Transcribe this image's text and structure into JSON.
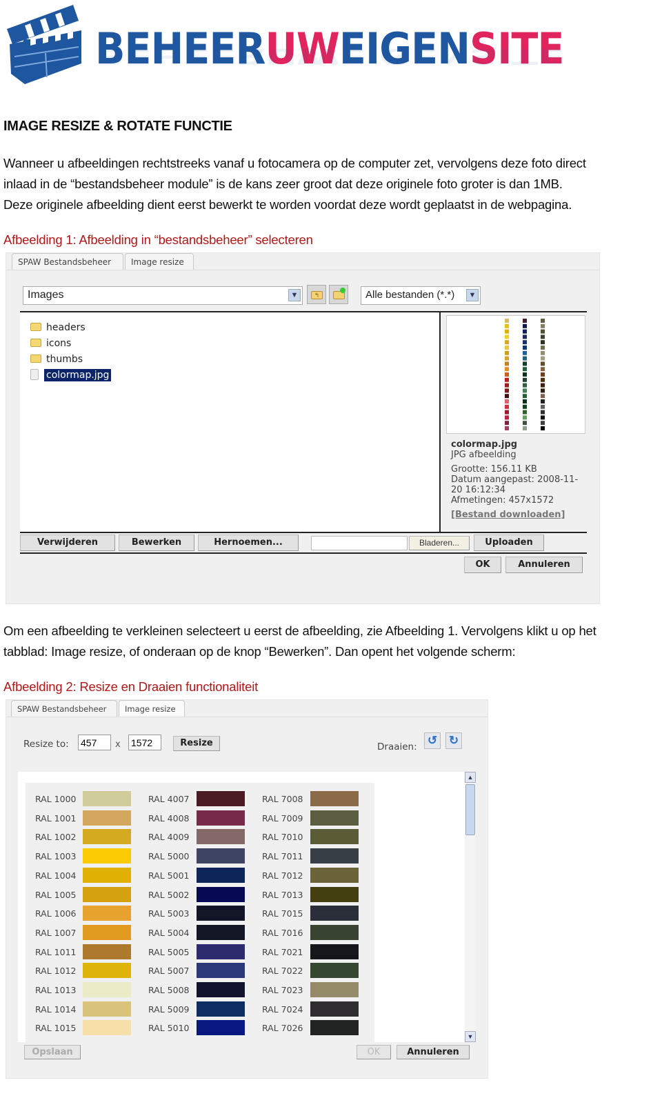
{
  "logo": {
    "part1": "BEHEER",
    "part2": "UW",
    "part3": "EIGEN",
    "part4": "SITE",
    "blue": "#1f56a0",
    "pink": "#e0245e"
  },
  "heading": "IMAGE RESIZE & ROTATE FUNCTIE",
  "intro": [
    "Wanneer u afbeeldingen rechtstreeks vanaf u fotocamera op de computer zet, vervolgens deze foto direct",
    "inlaad in de “bestandsbeheer module” is de kans zeer groot dat deze originele foto groter is dan 1MB.",
    "Deze originele afbeelding dient eerst bewerkt te worden voordat deze wordt geplaatst in de webpagina."
  ],
  "caption1": "Afbeelding 1: Afbeelding in “bestandsbeheer” selecteren",
  "dialog1": {
    "tabs": [
      "SPAW Bestandsbeheer",
      "Image resize"
    ],
    "folder_select": "Images",
    "filter_select": "Alle bestanden (*.*)",
    "files": [
      {
        "name": "headers",
        "type": "folder"
      },
      {
        "name": "icons",
        "type": "folder"
      },
      {
        "name": "thumbs",
        "type": "folder"
      },
      {
        "name": "colormap.jpg",
        "type": "file",
        "selected": true
      }
    ],
    "info": {
      "filename": "colormap.jpg",
      "filetype": "JPG afbeelding",
      "size": "Grootte: 156.11 KB",
      "date1": "Datum aangepast: 2008-11-",
      "date2": "20 16:12:34",
      "dims": "Afmetingen: 457x1572",
      "download": "[Bestand downloaden]"
    },
    "buttons": {
      "delete": "Verwijderen",
      "edit": "Bewerken",
      "rename": "Hernoemen...",
      "browse": "Bladeren...",
      "upload": "Uploaden",
      "ok": "OK",
      "cancel": "Annuleren"
    },
    "upload_value": ""
  },
  "para2": [
    "Om een afbeelding te verkleinen selecteert u eerst de afbeelding, zie Afbeelding 1. Vervolgens klikt u op het",
    "tabblad: Image resize, of onderaan op de knop “Bewerken”. Dan opent het volgende scherm:"
  ],
  "caption2": "Afbeelding 2: Resize en Draaien functionaliteit",
  "dialog2": {
    "tabs": [
      "SPAW Bestandsbeheer",
      "Image resize"
    ],
    "resize_label": "Resize to:",
    "width": "457",
    "x": "x",
    "height": "1572",
    "resize_button": "Resize",
    "rotate_label": "Draaien:",
    "save": "Opslaan",
    "ok": "OK",
    "cancel": "Annuleren",
    "colors": [
      [
        [
          "RAL 1000",
          "#cfcc9a"
        ],
        [
          "RAL 1001",
          "#d3a75e"
        ],
        [
          "RAL 1002",
          "#d2a91f"
        ],
        [
          "RAL 1003",
          "#fccb03"
        ],
        [
          "RAL 1004",
          "#e0b004"
        ],
        [
          "RAL 1005",
          "#d4a210"
        ],
        [
          "RAL 1006",
          "#e5a22c"
        ],
        [
          "RAL 1007",
          "#e09b20"
        ],
        [
          "RAL 1011",
          "#ad7a2d"
        ],
        [
          "RAL 1012",
          "#ddb50a"
        ],
        [
          "RAL 1013",
          "#ecebc8"
        ],
        [
          "RAL 1014",
          "#d8c27c"
        ],
        [
          "RAL 1015",
          "#f6dfa8"
        ]
      ],
      [
        [
          "RAL 4007",
          "#4b1c23"
        ],
        [
          "RAL 4008",
          "#772a4a"
        ],
        [
          "RAL 4009",
          "#836a68"
        ],
        [
          "RAL 5000",
          "#3d4563"
        ],
        [
          "RAL 5001",
          "#0e2559"
        ],
        [
          "RAL 5002",
          "#050a52"
        ],
        [
          "RAL 5003",
          "#121626"
        ],
        [
          "RAL 5004",
          "#131625"
        ],
        [
          "RAL 5005",
          "#2d2a6e"
        ],
        [
          "RAL 5007",
          "#2c3978"
        ],
        [
          "RAL 5008",
          "#12142e"
        ],
        [
          "RAL 5009",
          "#0e2e62"
        ],
        [
          "RAL 5010",
          "#081881"
        ]
      ],
      [
        [
          "RAL 7008",
          "#8b6a47"
        ],
        [
          "RAL 7009",
          "#5b5d40"
        ],
        [
          "RAL 7010",
          "#5b5b35"
        ],
        [
          "RAL 7011",
          "#383e45"
        ],
        [
          "RAL 7012",
          "#6a6438"
        ],
        [
          "RAL 7013",
          "#443f11"
        ],
        [
          "RAL 7015",
          "#2b2f39"
        ],
        [
          "RAL 7016",
          "#384431"
        ],
        [
          "RAL 7021",
          "#16171a"
        ],
        [
          "RAL 7022",
          "#354731"
        ],
        [
          "RAL 7023",
          "#948a67"
        ],
        [
          "RAL 7024",
          "#2e2c2e"
        ],
        [
          "RAL 7026",
          "#222424"
        ]
      ]
    ]
  }
}
